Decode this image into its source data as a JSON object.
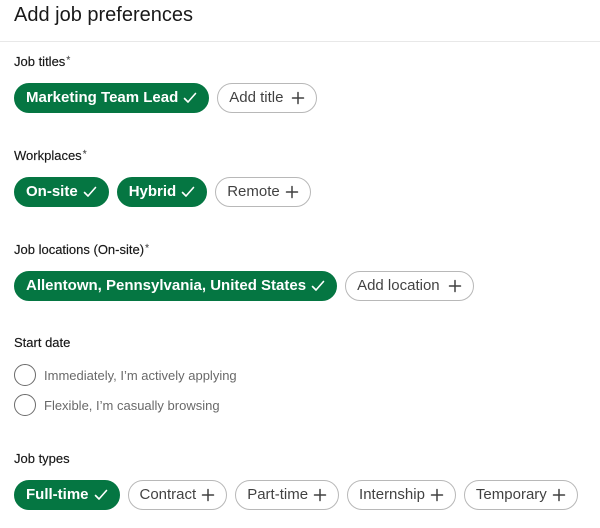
{
  "header": {
    "title": "Add job preferences"
  },
  "colors": {
    "selected_chip_bg": "#057642",
    "unselected_chip_border": "#b8b8b8",
    "divider": "#e8e8e8"
  },
  "sections": {
    "job_titles": {
      "label": "Job titles",
      "required_mark": "*",
      "chips": [
        {
          "label": "Marketing Team Lead",
          "selected": true,
          "icon": "check-icon"
        },
        {
          "label": "Add title",
          "selected": false,
          "icon": "plus-icon"
        }
      ]
    },
    "workplaces": {
      "label": "Workplaces",
      "required_mark": "*",
      "chips": [
        {
          "label": "On-site",
          "selected": true,
          "icon": "check-icon"
        },
        {
          "label": "Hybrid",
          "selected": true,
          "icon": "check-icon"
        },
        {
          "label": "Remote",
          "selected": false,
          "icon": "plus-icon"
        }
      ]
    },
    "job_locations": {
      "label": "Job locations (On-site)",
      "required_mark": "*",
      "chips": [
        {
          "label": "Allentown, Pennsylvania, United States",
          "selected": true,
          "icon": "check-icon"
        },
        {
          "label": "Add location",
          "selected": false,
          "icon": "plus-icon"
        }
      ]
    },
    "start_date": {
      "label": "Start date",
      "options": [
        {
          "label": "Immediately, I’m actively applying",
          "checked": false
        },
        {
          "label": "Flexible, I’m casually browsing",
          "checked": false
        }
      ]
    },
    "job_types": {
      "label": "Job types",
      "chips": [
        {
          "label": "Full-time",
          "selected": true,
          "icon": "check-icon"
        },
        {
          "label": "Contract",
          "selected": false,
          "icon": "plus-icon"
        },
        {
          "label": "Part-time",
          "selected": false,
          "icon": "plus-icon"
        },
        {
          "label": "Internship",
          "selected": false,
          "icon": "plus-icon"
        },
        {
          "label": "Temporary",
          "selected": false,
          "icon": "plus-icon"
        }
      ]
    }
  }
}
